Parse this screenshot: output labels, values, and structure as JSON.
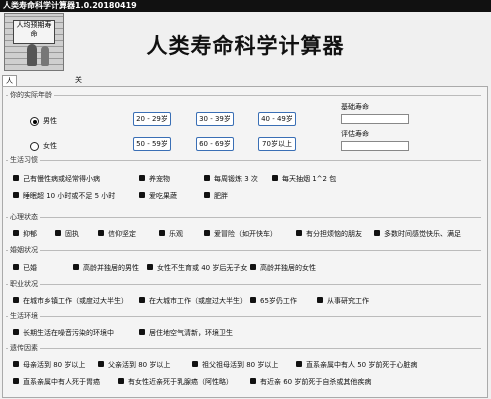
{
  "window": {
    "title": "人类寿命科学计算器1.0.20180419"
  },
  "banner": {
    "sign_text": "人均预期寿命"
  },
  "header": {
    "title": "人类寿命科学计算器"
  },
  "tabs": [
    {
      "label": "人类寿命科学计算器"
    },
    {
      "label": "关于"
    }
  ],
  "age_section": {
    "legend": "你的实际年龄",
    "male": "男性",
    "female": "女性",
    "male_ranges": [
      "20 - 29岁",
      "30 - 39岁",
      "40 - 49岁"
    ],
    "female_ranges": [
      "50 - 59岁",
      "60 - 69岁",
      "70岁以上"
    ],
    "base_life_label": "基础寿命",
    "eval_life_label": "评估寿命"
  },
  "sections": [
    {
      "legend": "生活习惯",
      "rows": [
        [
          "己有慢性病或经常得小病",
          "养宠物",
          "每周锻炼 3 次",
          "每天抽烟 1^2 包"
        ],
        [
          "睡眠超 10 小时或不足 5 小时",
          "爱吃果蔬",
          "肥胖"
        ]
      ]
    },
    {
      "legend": "心理状态",
      "rows": [
        [
          "抑郁",
          "固执",
          "信仰坚定",
          "乐观",
          "爱冒险（如开快车）",
          "有分担烦恼的朋友",
          "多数时间感觉快乐、满足"
        ]
      ]
    },
    {
      "legend": "婚姻状况",
      "rows": [
        [
          "已婚",
          "高龄并独居的男性",
          "女性不生育或 40 岁后无子女",
          "高龄并独居的女性"
        ]
      ]
    },
    {
      "legend": "职业状况",
      "rows": [
        [
          "在城市乡镇工作（或度过大半生）",
          "在大城市工作（或度过大半生）",
          "65岁仍工作",
          "从事研究工作"
        ]
      ]
    },
    {
      "legend": "生活环境",
      "rows": [
        [
          "长期生活在噪音污染的环境中",
          "居住地空气清新，环境卫生"
        ]
      ]
    },
    {
      "legend": "遗传因素",
      "rows": [
        [
          "母亲活到 80 岁以上",
          "父亲活到 80 岁以上",
          "祖父祖母活到 80 岁以上",
          "直系亲属中有人 50 岁前死于心脏病"
        ],
        [
          "直系亲属中有人死于胃癌",
          "有女性近亲死于乳腺癌（阿性略）",
          "有近亲 60 岁前死于自杀或其他疾病"
        ]
      ]
    }
  ]
}
